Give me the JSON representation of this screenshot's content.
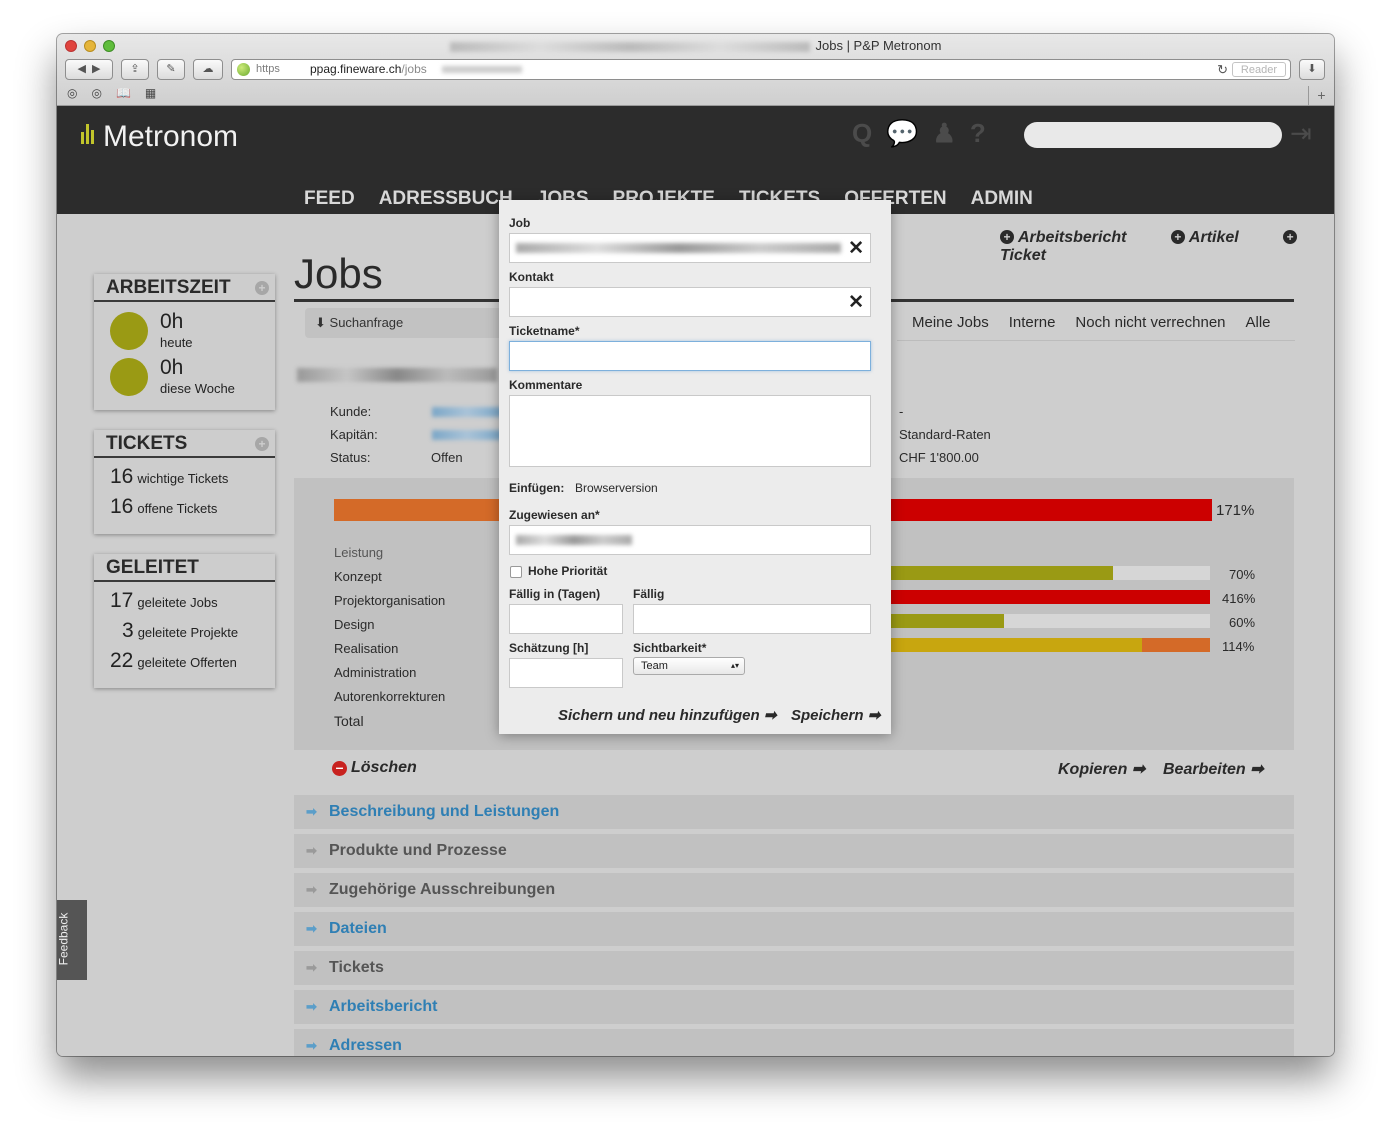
{
  "browser": {
    "window_title": "Jobs | P&P Metronom",
    "url_scheme": "https",
    "url_host": "ppag.fineware.ch",
    "url_path": "/jobs",
    "reader_label": "Reader"
  },
  "app": {
    "logo_text": "Metronom",
    "nav": [
      "FEED",
      "ADRESSBUCH",
      "JOBS",
      "PROJEKTE",
      "TICKETS",
      "OFFERTEN",
      "ADMIN"
    ]
  },
  "sidebar": {
    "arbeitszeit": {
      "title": "ARBEITSZEIT",
      "rows": [
        {
          "value": "0h",
          "label": "heute"
        },
        {
          "value": "0h",
          "label": "diese Woche"
        }
      ]
    },
    "tickets": {
      "title": "TICKETS",
      "rows": [
        {
          "count": "16",
          "label": "wichtige Tickets"
        },
        {
          "count": "16",
          "label": "offene Tickets"
        }
      ]
    },
    "geleitet": {
      "title": "GELEITET",
      "rows": [
        {
          "count": "17",
          "label": "geleitete Jobs"
        },
        {
          "count": "3",
          "label": "geleitete Projekte"
        },
        {
          "count": "22",
          "label": "geleitete Offerten"
        }
      ]
    }
  },
  "main": {
    "title": "Jobs",
    "top_actions": [
      "Arbeitsbericht",
      "Artikel",
      "Ticket"
    ],
    "suchanfrage": "Suchanfrage",
    "filters": [
      "Meine Jobs",
      "Interne",
      "Noch nicht verrechnen",
      "Alle"
    ],
    "meta": {
      "kunde_label": "Kunde:",
      "kapitaen_label": "Kapitän:",
      "status_label": "Status:",
      "status_value": "Offen",
      "right_dash": "-",
      "raten": "Standard-Raten",
      "betrag": "CHF 1'800.00"
    },
    "performance": {
      "total_pct": "171%",
      "total_fraction": 1.71,
      "labels": [
        "Leistung",
        "Konzept",
        "Projektorganisation",
        "Design",
        "Realisation",
        "Administration",
        "Autorenkorrekturen",
        "Total"
      ],
      "rows": [
        {
          "name": "Konzept",
          "pct": "70%",
          "fraction": 0.7,
          "color": "#9a9a14"
        },
        {
          "name": "Projektorganisation",
          "pct": "416%",
          "fraction": 4.16,
          "color": "#cc0000"
        },
        {
          "name": "Design",
          "pct": "60%",
          "fraction": 0.6,
          "color": "#9a9a14"
        },
        {
          "name": "Realisation",
          "pct": "114%",
          "fraction": 1.14,
          "color": "#c8a60f"
        }
      ]
    },
    "delete_label": "Löschen",
    "copy_label": "Kopieren",
    "edit_label": "Bearbeiten",
    "sections": [
      {
        "label": "Beschreibung und Leistungen",
        "style": "blue"
      },
      {
        "label": "Produkte und Prozesse",
        "style": "gray"
      },
      {
        "label": "Zugehörige Ausschreibungen",
        "style": "gray"
      },
      {
        "label": "Dateien",
        "style": "blue"
      },
      {
        "label": "Tickets",
        "style": "gray"
      },
      {
        "label": "Arbeitsbericht",
        "style": "blue"
      },
      {
        "label": "Adressen",
        "style": "blue"
      }
    ],
    "feedback_label": "Feedback"
  },
  "modal": {
    "job_label": "Job",
    "kontakt_label": "Kontakt",
    "ticketname_label": "Ticketname*",
    "ticketname_value": "",
    "kommentare_label": "Kommentare",
    "kommentare_value": "",
    "einfuegen_label": "Einfügen:",
    "einfuegen_value": "Browserversion",
    "zugewiesen_label": "Zugewiesen an*",
    "hohe_prio_label": "Hohe Priorität",
    "hohe_prio_checked": false,
    "faellig_tage_label": "Fällig in (Tagen)",
    "faellig_label": "Fällig",
    "schaetzung_label": "Schätzung [h]",
    "sichtbarkeit_label": "Sichtbarkeit*",
    "sichtbarkeit_value": "Team",
    "save_new_label": "Sichern und neu hinzufügen",
    "save_label": "Speichern"
  }
}
